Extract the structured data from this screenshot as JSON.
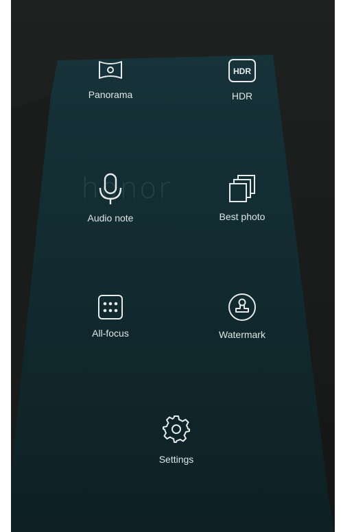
{
  "camera_modes": {
    "items": [
      {
        "id": "panorama",
        "label": "Panorama",
        "icon": "panorama-icon"
      },
      {
        "id": "hdr",
        "label": "HDR",
        "icon": "hdr-icon",
        "icon_text": "HDR"
      },
      {
        "id": "audio-note",
        "label": "Audio note",
        "icon": "microphone-icon"
      },
      {
        "id": "best-photo",
        "label": "Best photo",
        "icon": "stacked-photos-icon"
      },
      {
        "id": "all-focus",
        "label": "All-focus",
        "icon": "all-focus-icon"
      },
      {
        "id": "watermark",
        "label": "Watermark",
        "icon": "stamp-icon"
      },
      {
        "id": "settings",
        "label": "Settings",
        "icon": "gear-icon"
      }
    ]
  },
  "background": {
    "logo_text": "honor",
    "colors": {
      "box_top": "#143036",
      "box_bottom": "#0f2125",
      "surround": "#1c1e1e"
    }
  },
  "colors": {
    "icon_stroke": "#e6ecec",
    "label_text": "#dfe6e6"
  }
}
